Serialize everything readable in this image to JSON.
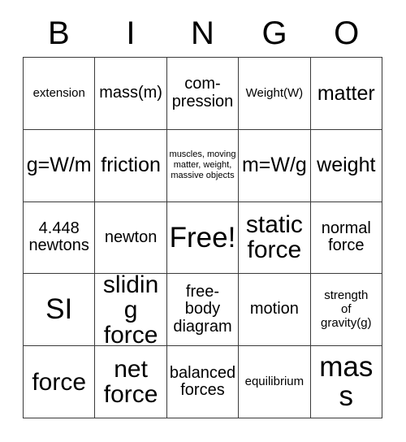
{
  "card": {
    "title": "BINGO",
    "header_letters": [
      "B",
      "I",
      "N",
      "G",
      "O"
    ],
    "free_space_label": "Free!",
    "colors": {
      "background": "#ffffff",
      "text": "#000000",
      "grid_line": "#3a3a3a"
    },
    "grid": {
      "columns": 5,
      "rows": 5,
      "cells": [
        {
          "text": "extension",
          "size": "sm"
        },
        {
          "text": "mass(m)",
          "size": "md"
        },
        {
          "text": "com-\npression",
          "size": "md"
        },
        {
          "text": "Weight(W)",
          "size": "sm"
        },
        {
          "text": "matter",
          "size": "lg"
        },
        {
          "text": "g=W/m",
          "size": "lg"
        },
        {
          "text": "friction",
          "size": "lg"
        },
        {
          "text": "muscles, moving matter, weight, massive objects",
          "size": "xs"
        },
        {
          "text": "m=W/g",
          "size": "lg"
        },
        {
          "text": "weight",
          "size": "lg"
        },
        {
          "text": "4.448\nnewtons",
          "size": "md"
        },
        {
          "text": "newton",
          "size": "md"
        },
        {
          "text": "Free!",
          "size": "xxl"
        },
        {
          "text": "static\nforce",
          "size": "xl"
        },
        {
          "text": "normal\nforce",
          "size": "md"
        },
        {
          "text": "SI",
          "size": "xxl"
        },
        {
          "text": "sliding\nforce",
          "size": "xl"
        },
        {
          "text": "free-\nbody\ndiagram",
          "size": "md"
        },
        {
          "text": "motion",
          "size": "md"
        },
        {
          "text": "strength\nof\ngravity(g)",
          "size": "sm"
        },
        {
          "text": "force",
          "size": "xl"
        },
        {
          "text": "net\nforce",
          "size": "xl"
        },
        {
          "text": "balanced\nforces",
          "size": "md"
        },
        {
          "text": "equilibrium",
          "size": "sm"
        },
        {
          "text": "mass",
          "size": "xxl"
        }
      ]
    }
  }
}
